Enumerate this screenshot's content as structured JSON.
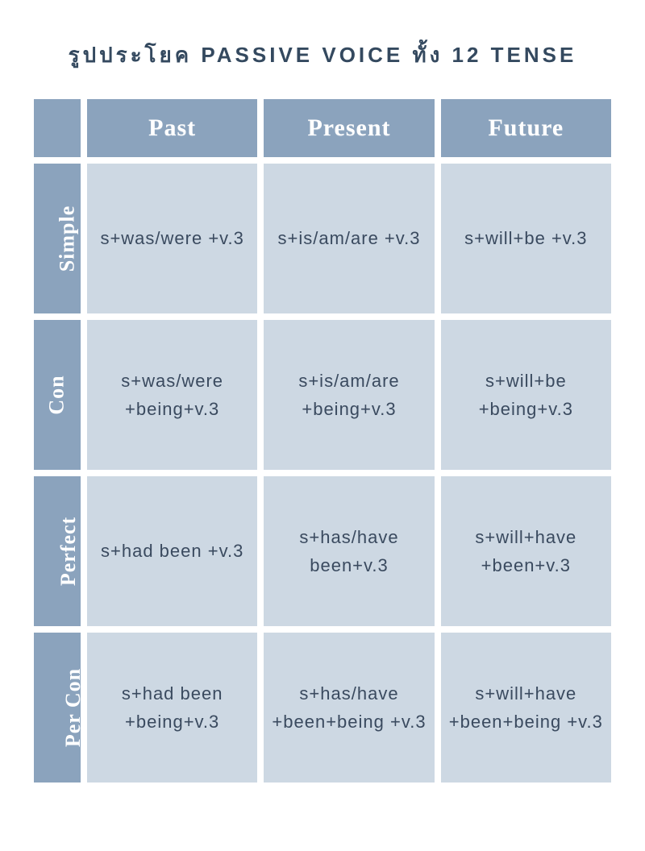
{
  "title": "รูปประโยค PASSIVE VOICE ทั้ง 12 TENSE",
  "columns": [
    "Past",
    "Present",
    "Future"
  ],
  "rows": [
    {
      "label": "Simple",
      "cells": [
        "s+was/were +v.3",
        "s+is/am/are +v.3",
        "s+will+be +v.3"
      ]
    },
    {
      "label": "Con",
      "cells": [
        "s+was/were +being+v.3",
        "s+is/am/are +being+v.3",
        "s+will+be +being+v.3"
      ]
    },
    {
      "label": "Perfect",
      "cells": [
        "s+had been +v.3",
        "s+has/have been+v.3",
        "s+will+have +been+v.3"
      ]
    },
    {
      "label": "Per Con",
      "cells": [
        "s+had been +being+v.3",
        "s+has/have +been+being +v.3",
        "s+will+have +been+being +v.3"
      ]
    }
  ],
  "chart_data": {
    "type": "table",
    "title": "รูปประโยค PASSIVE VOICE ทั้ง 12 TENSE",
    "columns": [
      "",
      "Past",
      "Present",
      "Future"
    ],
    "rows": [
      [
        "Simple",
        "s+was/were+v.3",
        "s+is/am/are+v.3",
        "s+will+be+v.3"
      ],
      [
        "Con",
        "s+was/were+being+v.3",
        "s+is/am/are+being+v.3",
        "s+will+be+being+v.3"
      ],
      [
        "Perfect",
        "s+had been+v.3",
        "s+has/have been+v.3",
        "s+will+have+been+v.3"
      ],
      [
        "Per Con",
        "s+had been+being+v.3",
        "s+has/have+been+being+v.3",
        "s+will+have+been+being+v.3"
      ]
    ]
  },
  "colors": {
    "header_bg": "#8ba3bd",
    "cell_bg": "#cdd8e3",
    "header_text": "#ffffff",
    "cell_text": "#3a4a5f",
    "title_text": "#34495f"
  }
}
